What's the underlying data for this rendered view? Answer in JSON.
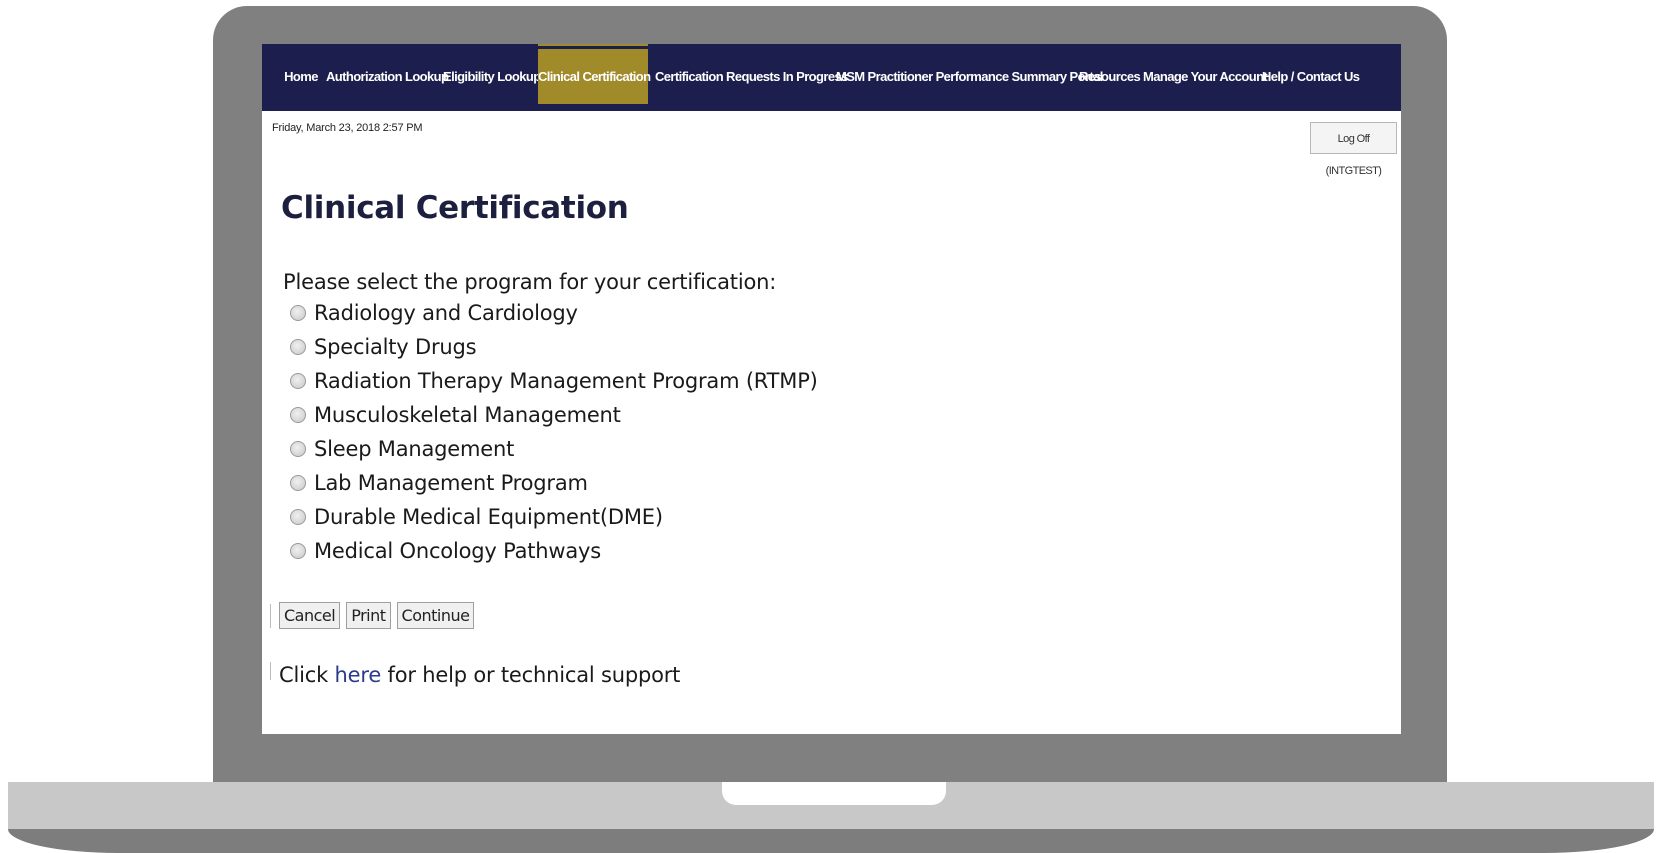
{
  "nav": {
    "items": [
      {
        "label": "Home",
        "active": false
      },
      {
        "label": "Authorization Lookup",
        "active": false
      },
      {
        "label": "Eligibility Lookup",
        "active": false
      },
      {
        "label": "Clinical Certification",
        "active": true
      },
      {
        "label": "Certification Requests In Progress",
        "active": false
      },
      {
        "label": "MSM Practitioner Performance Summary Portal",
        "active": false
      },
      {
        "label": "Resources",
        "active": false
      },
      {
        "label": "Manage Your Account",
        "active": false
      },
      {
        "label": "Help / Contact Us",
        "active": false
      }
    ]
  },
  "header": {
    "datetime": "Friday, March 23, 2018 2:57 PM",
    "logoff_label": "Log Off (INTGTEST)"
  },
  "main": {
    "title": "Clinical Certification",
    "prompt": "Please select the program for your certification:",
    "programs": [
      "Radiology and Cardiology",
      "Specialty Drugs",
      "Radiation Therapy Management Program (RTMP)",
      "Musculoskeletal Management",
      "Sleep Management",
      "Lab Management Program",
      "Durable Medical Equipment(DME)",
      "Medical Oncology Pathways"
    ],
    "buttons": {
      "cancel": "Cancel",
      "print": "Print",
      "continue": "Continue"
    },
    "help": {
      "prefix": "Click ",
      "link": "here",
      "suffix": " for help or technical support"
    }
  },
  "colors": {
    "nav_background": "#1c1f4e",
    "nav_active": "#a08a2a",
    "laptop_frame": "#808080"
  }
}
